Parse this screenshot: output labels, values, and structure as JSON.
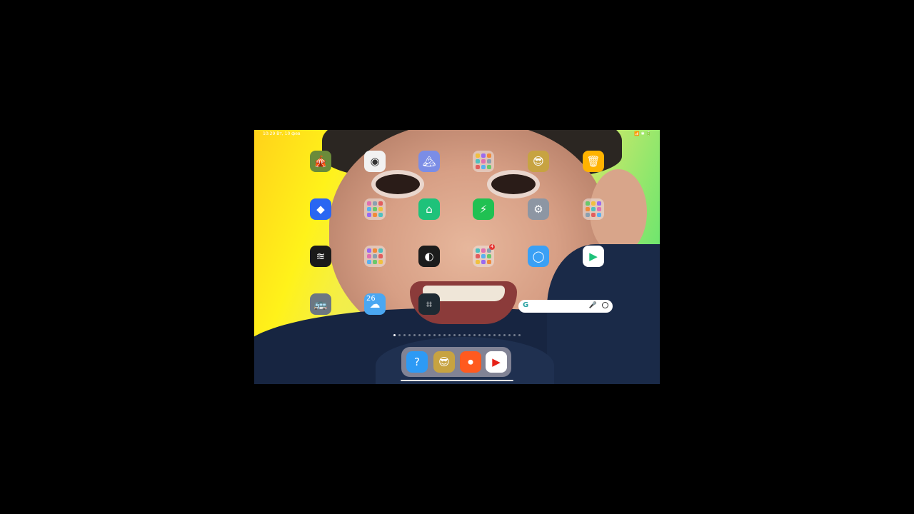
{
  "status_bar": {
    "time_date": "10:29 Вт, 10 фев",
    "right_indicators": "📶 ✱ 🔋"
  },
  "apps": [
    {
      "name": "game-icon-app",
      "row": 0,
      "col": 0,
      "bg": "#6b8b3a",
      "glyph": "🎪"
    },
    {
      "name": "camera-app",
      "row": 0,
      "col": 1,
      "bg": "#f2f2f2",
      "glyph": "◉"
    },
    {
      "name": "gallery-app",
      "row": 0,
      "col": 2,
      "bg": "#7b8de6",
      "glyph": "🏔"
    },
    {
      "name": "folder-top",
      "row": 0,
      "col": 3,
      "folder": true
    },
    {
      "name": "game-character-app",
      "row": 0,
      "col": 4,
      "bg": "#c7a341",
      "glyph": "😎"
    },
    {
      "name": "cleaner-app",
      "row": 0,
      "col": 5,
      "bg": "#ffb300",
      "glyph": "🗑"
    },
    {
      "name": "roblox-app",
      "row": 1,
      "col": 0,
      "bg": "#2a66f2",
      "glyph": "◆"
    },
    {
      "name": "folder-games",
      "row": 1,
      "col": 1,
      "folder": true
    },
    {
      "name": "mi-home-app",
      "row": 1,
      "col": 2,
      "bg": "#1ec27a",
      "glyph": "⌂"
    },
    {
      "name": "security-app",
      "row": 1,
      "col": 3,
      "bg": "#20c152",
      "glyph": "⚡"
    },
    {
      "name": "settings-app",
      "row": 1,
      "col": 4,
      "bg": "#8d96a3",
      "glyph": "⚙"
    },
    {
      "name": "folder-google",
      "row": 1,
      "col": 5,
      "folder": true
    },
    {
      "name": "recorder-app",
      "row": 2,
      "col": 0,
      "bg": "#1a1a1a",
      "glyph": "≋"
    },
    {
      "name": "folder-tools",
      "row": 2,
      "col": 1,
      "folder": true
    },
    {
      "name": "themes-app",
      "row": 2,
      "col": 2,
      "bg": "#1c1c1c",
      "glyph": "◐"
    },
    {
      "name": "folder-more",
      "row": 2,
      "col": 3,
      "folder": true,
      "badge": "4"
    },
    {
      "name": "browser-app",
      "row": 2,
      "col": 4,
      "bg": "#3aa0f5",
      "glyph": "◯"
    },
    {
      "name": "play-store-app",
      "row": 2,
      "col": 5,
      "bg": "#ffffff",
      "glyph": "▶"
    },
    {
      "name": "game-bus-app",
      "row": 3,
      "col": 0,
      "bg": "#6c7782",
      "glyph": "🚌"
    },
    {
      "name": "weather-app",
      "row": 3,
      "col": 1,
      "bg": "#4aa7f2",
      "glyph": "☁"
    },
    {
      "name": "scanner-app",
      "row": 3,
      "col": 2,
      "bg": "#1e2a33",
      "glyph": "⌗"
    }
  ],
  "weather_app_temp": "26",
  "folder_badge": "4",
  "dock": [
    {
      "name": "help-app",
      "bg": "#2d9af5",
      "glyph": "?"
    },
    {
      "name": "game-dock-app",
      "bg": "#c7a341",
      "glyph": "😎"
    },
    {
      "name": "screen-recorder-app",
      "bg": "#ff5a1f",
      "glyph": "⏺"
    },
    {
      "name": "youtube-app",
      "bg": "#ffffff",
      "glyph": "▶"
    }
  ],
  "search_widget": {
    "g_glyph": "G",
    "mic_glyph": "🎤"
  },
  "page_dots": {
    "count": 26,
    "active_index": 0
  }
}
